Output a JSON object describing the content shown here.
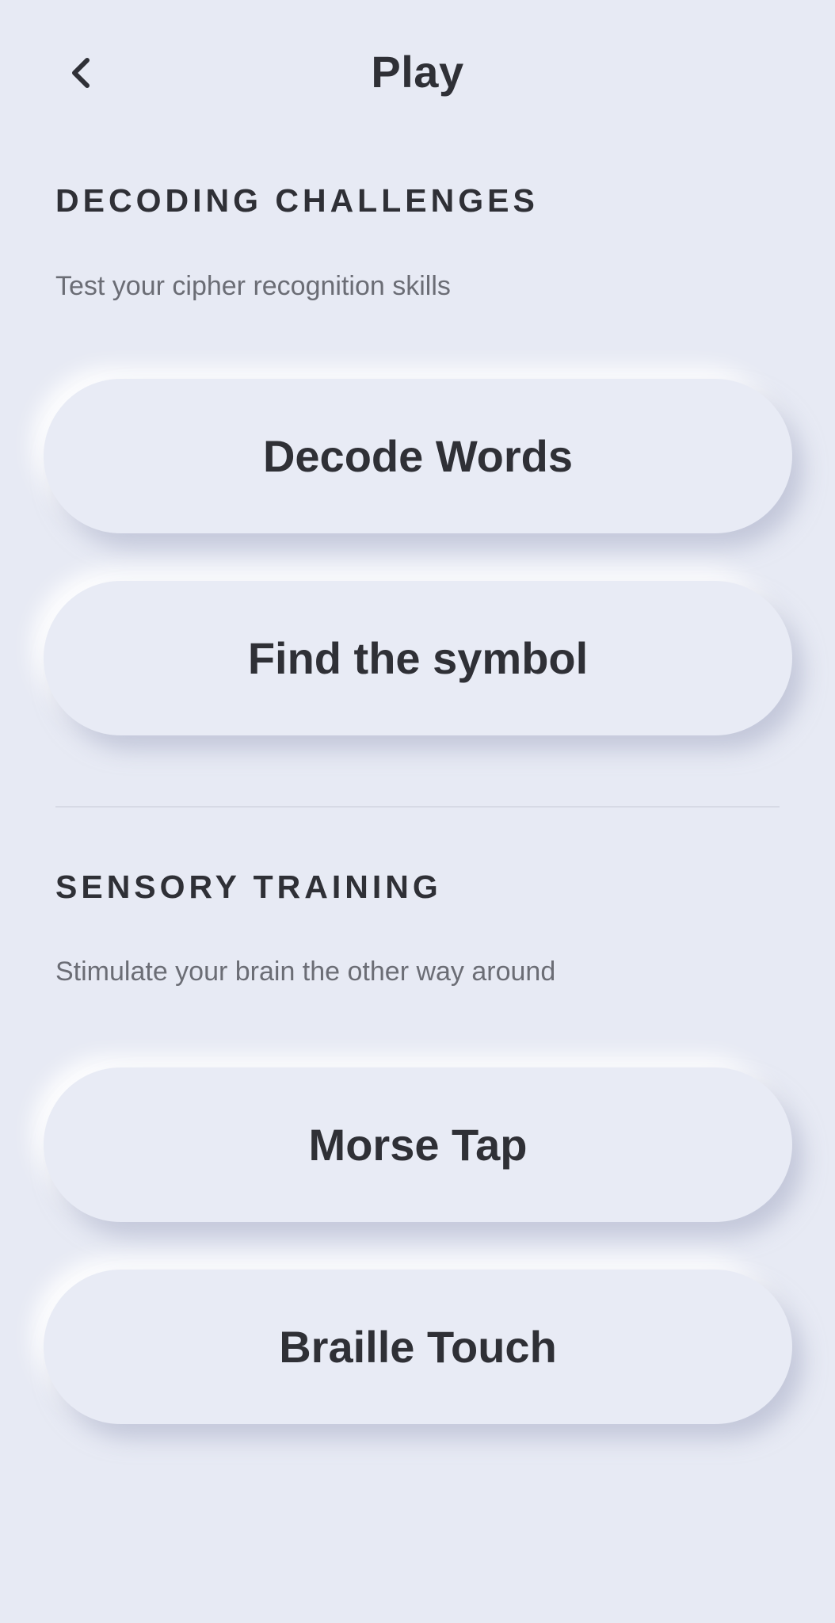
{
  "header": {
    "title": "Play",
    "back_icon": "chevron-left-icon"
  },
  "sections": [
    {
      "title": "DECODING CHALLENGES",
      "subtitle": "Test your cipher recognition skills",
      "buttons": [
        "Decode Words",
        "Find the symbol"
      ]
    },
    {
      "title": "SENSORY TRAINING",
      "subtitle": "Stimulate your brain the other way around",
      "buttons": [
        "Morse Tap",
        "Braille Touch"
      ]
    }
  ],
  "colors": {
    "background": "#e7eaf4",
    "text": "#2f3036",
    "subtext": "#6b6d75"
  }
}
